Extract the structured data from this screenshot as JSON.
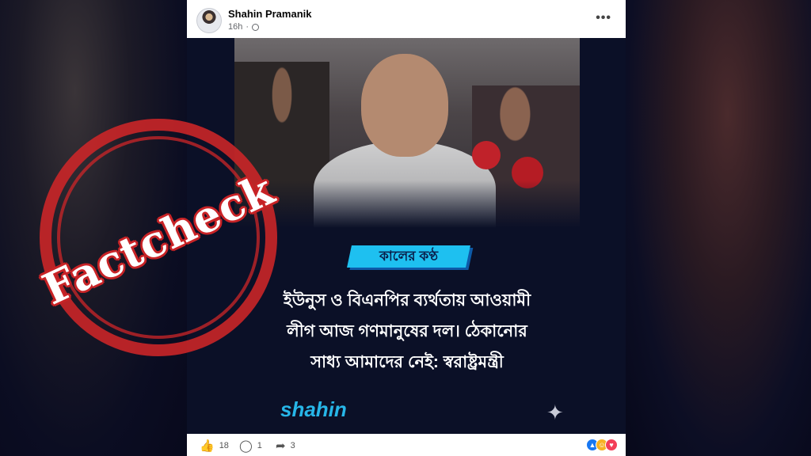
{
  "post": {
    "author": "Shahin Pramanik",
    "time": "16h",
    "privacy_icon": "globe-icon",
    "more_icon": "more-options-icon",
    "more_label": "•••"
  },
  "media": {
    "outlet_logo_text": "কালের কণ্ঠ",
    "headline_lines": [
      "ইউনুস ও বিএনপির ব্যর্থতায় আওয়ামী",
      "লীগ আজ গণমানুষের দল। ঠেকানোর",
      "সাধ্য আমাদের নেই: স্বরাষ্ট্রমন্ত্রী"
    ],
    "watermark_brand": "shahin",
    "sparkle_glyph": "✦"
  },
  "footer": {
    "likes_count": "18",
    "comments_count": "1",
    "shares_count": "3",
    "like_glyph": "👍",
    "comment_glyph": "◯",
    "share_glyph": "➦"
  },
  "overlay": {
    "stamp_text": "Factcheck",
    "stamp_color": "#ce2628"
  },
  "colors": {
    "brand_blue": "#27b6e8",
    "logo_tag": "#1ec0f0",
    "background": "#0b1027"
  }
}
